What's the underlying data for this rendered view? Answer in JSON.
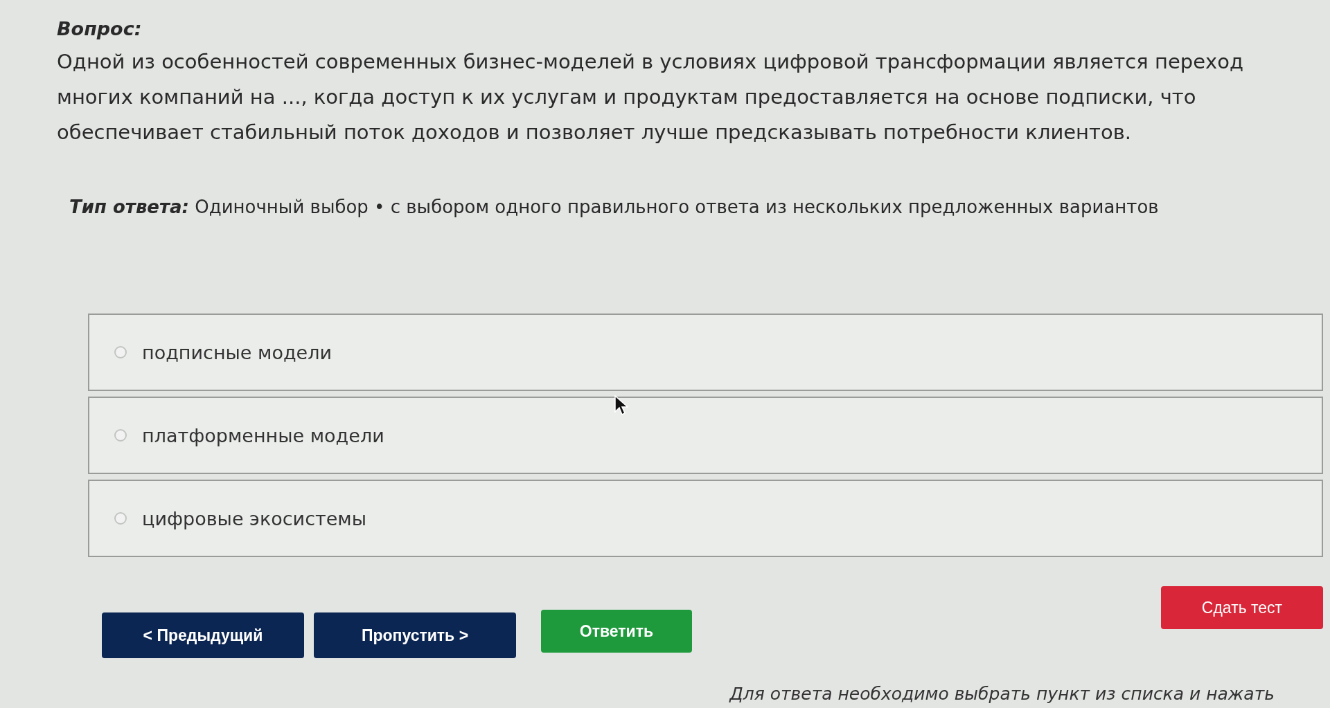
{
  "question": {
    "label": "Вопрос:",
    "text": "Одной из особенностей современных бизнес-моделей в условиях цифровой трансформации является переход многих компаний на ..., когда доступ к их услугам и продуктам предоставляется на основе подписки, что обеспечивает стабильный поток доходов и позволяет лучше предсказывать потребности клиентов."
  },
  "answer_type": "*Тип ответа:* Одиночный выбор • с выбором одного правильного ответа из нескольких предложенных вариантов",
  "options": [
    {
      "label": "подписные модели",
      "selected": false
    },
    {
      "label": "платформенные модели",
      "selected": false
    },
    {
      "label": "цифровые экосистемы",
      "selected": false
    }
  ],
  "buttons": [
    {
      "label": "< Предыдущий",
      "kind": "nav"
    },
    {
      "label": "Пропустить >",
      "kind": "nav"
    },
    {
      "label": "Ответить",
      "kind": "submit"
    },
    {
      "label": "Сдать тест",
      "kind": "finish"
    }
  ],
  "hint": "Для ответа необходимо выбрать пункт из списка и нажать"
}
